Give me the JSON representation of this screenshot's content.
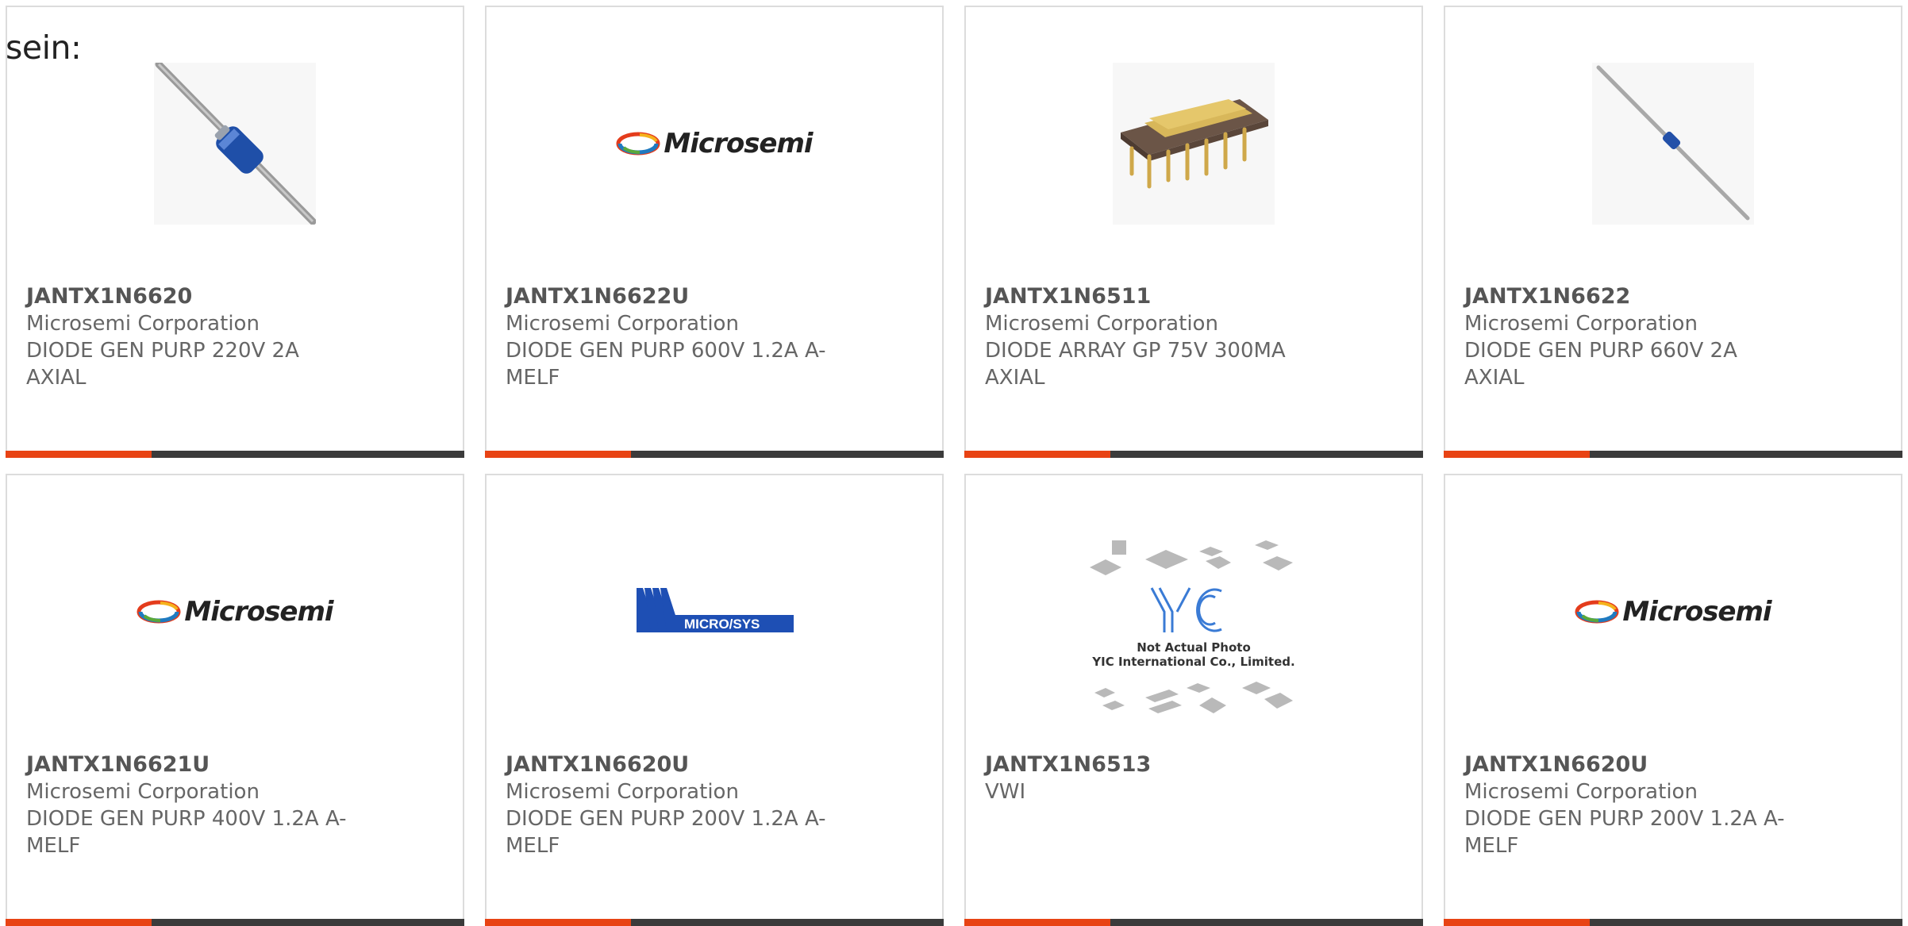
{
  "header": {
    "lead_text": "sein:"
  },
  "products": [
    {
      "part_number": "JANTX1N6620",
      "manufacturer": "Microsemi Corporation",
      "description": "DIODE GEN PURP 220V 2A AXIAL",
      "image": "axial-diode-photo"
    },
    {
      "part_number": "JANTX1N6622U",
      "manufacturer": "Microsemi Corporation",
      "description": "DIODE GEN PURP 600V 1.2A A-MELF",
      "image": "microsemi-logo",
      "logo_text": "Microsemi"
    },
    {
      "part_number": "JANTX1N6511",
      "manufacturer": "Microsemi Corporation",
      "description": "DIODE ARRAY GP 75V 300MA AXIAL",
      "image": "dip-package-photo"
    },
    {
      "part_number": "JANTX1N6622",
      "manufacturer": "Microsemi Corporation",
      "description": "DIODE GEN PURP 660V 2A AXIAL",
      "image": "thin-axial-diode-photo"
    },
    {
      "part_number": "JANTX1N6621U",
      "manufacturer": "Microsemi Corporation",
      "description": "DIODE GEN PURP 400V 1.2A A-MELF",
      "image": "microsemi-logo",
      "logo_text": "Microsemi"
    },
    {
      "part_number": "JANTX1N6620U",
      "manufacturer": "Microsemi Corporation",
      "description": "DIODE GEN PURP 200V 1.2A A-MELF",
      "image": "microsys-logo",
      "logo_text": "MICRO/SYS"
    },
    {
      "part_number": "JANTX1N6513",
      "manufacturer": "VWI",
      "description": "",
      "image": "placeholder-photo",
      "placeholder_lines": [
        "Not Actual Photo",
        "YIC International Co., Limited."
      ]
    },
    {
      "part_number": "JANTX1N6620U",
      "manufacturer": "Microsemi Corporation",
      "description": "DIODE GEN PURP 200V 1.2A A-MELF",
      "image": "microsemi-logo",
      "logo_text": "Microsemi"
    }
  ],
  "colors": {
    "accent": "#e84314",
    "bar": "#3b3b3b",
    "border": "#dcdcdc",
    "text": "#555555"
  }
}
